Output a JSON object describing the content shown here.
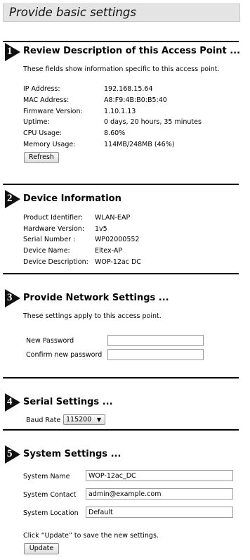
{
  "page": {
    "title": "Provide basic settings"
  },
  "sections": {
    "s1": {
      "number": "1",
      "title": "Review Description of this Access Point ...",
      "intro": "These fields show information specific to this access point.",
      "fields": [
        {
          "label": "IP Address:",
          "value": "192.168.15.64"
        },
        {
          "label": "MAC Address:",
          "value": "A8:F9:4B:B0:B5:40"
        },
        {
          "label": "Firmware Version:",
          "value": "1.10.1.13"
        },
        {
          "label": "Uptime:",
          "value": "0 days, 20 hours, 35 minutes"
        },
        {
          "label": "CPU Usage:",
          "value": "8.60%"
        },
        {
          "label": "Memory Usage:",
          "value": "114MB/248MB (46%)"
        }
      ],
      "refresh_label": "Refresh"
    },
    "s2": {
      "number": "2",
      "title": "Device Information",
      "fields": [
        {
          "label": "Product Identifier:",
          "value": "WLAN-EAP"
        },
        {
          "label": "Hardware Version:",
          "value": "1v5"
        },
        {
          "label": "Serial Number :",
          "value": "WP02000552"
        },
        {
          "label": "Device Name:",
          "value": "Eltex-AP"
        },
        {
          "label": "Device Description:",
          "value": "WOP-12ac DC"
        }
      ]
    },
    "s3": {
      "number": "3",
      "title": "Provide Network Settings ...",
      "intro": "These settings apply to this access point.",
      "new_password_label": "New Password",
      "new_password_value": "",
      "confirm_password_label": "Confirm new password",
      "confirm_password_value": ""
    },
    "s4": {
      "number": "4",
      "title": "Serial Settings ...",
      "baud_label": "Baud Rate",
      "baud_value": "115200"
    },
    "s5": {
      "number": "5",
      "title": "System Settings ...",
      "system_name_label": "System Name",
      "system_name_value": "WOP-12ac_DC",
      "system_contact_label": "System Contact",
      "system_contact_value": "admin@example.com",
      "system_location_label": "System Location",
      "system_location_value": "Default",
      "hint": "Click “Update” to save the new settings.",
      "update_label": "Update"
    }
  }
}
